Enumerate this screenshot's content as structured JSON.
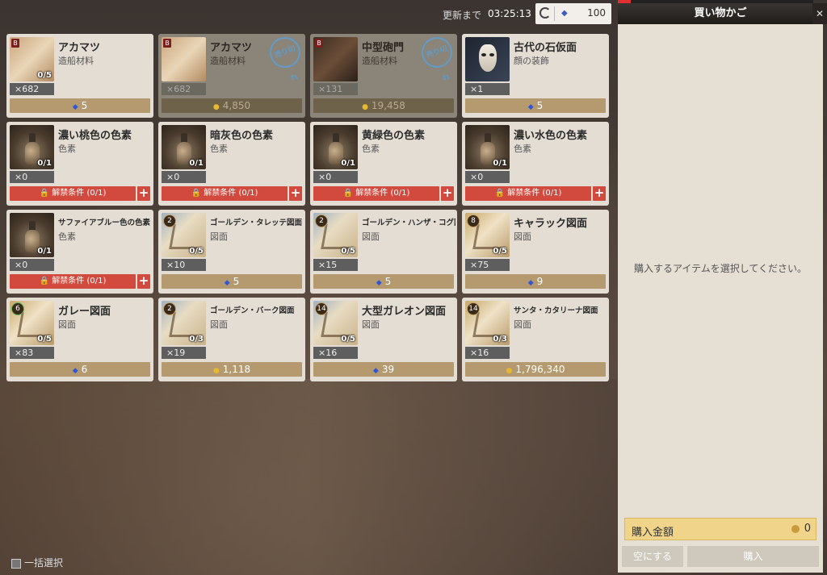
{
  "header": {
    "timer_label": "更新まで",
    "timer_value": "03:25:13",
    "gem_balance": "100"
  },
  "items": [
    {
      "name": "アカマツ",
      "category": "造船材料",
      "qty": "×682",
      "stock": "0/5",
      "price": "5",
      "currency": "gem",
      "thumb": "lumber",
      "badge": "B",
      "sold_out": false
    },
    {
      "name": "アカマツ",
      "category": "造船材料",
      "qty": "×682",
      "stock": "",
      "price": "4,850",
      "currency": "gold",
      "thumb": "lumber",
      "badge": "B",
      "sold_out": true,
      "stamp": "売り切れ"
    },
    {
      "name": "中型砲門",
      "category": "造船材料",
      "qty": "×131",
      "stock": "",
      "price": "19,458",
      "currency": "gold",
      "thumb": "cannon",
      "badge": "B",
      "sold_out": true,
      "stamp": "売り切れ"
    },
    {
      "name": "古代の石仮面",
      "category": "顔の装飾",
      "qty": "×1",
      "stock": "",
      "price": "5",
      "currency": "gem",
      "thumb": "mask",
      "badge": "",
      "sold_out": false
    },
    {
      "name": "濃い桃色の色素",
      "category": "色素",
      "qty": "×0",
      "stock": "0/1",
      "locked": true,
      "thumb": "bottle"
    },
    {
      "name": "暗灰色の色素",
      "category": "色素",
      "qty": "×0",
      "stock": "0/1",
      "locked": true,
      "thumb": "bottle"
    },
    {
      "name": "黄緑色の色素",
      "category": "色素",
      "qty": "×0",
      "stock": "0/1",
      "locked": true,
      "thumb": "bottle"
    },
    {
      "name": "濃い水色の色素",
      "category": "色素",
      "qty": "×0",
      "stock": "0/1",
      "locked": true,
      "thumb": "bottle"
    },
    {
      "name": "サファイアブルー色の色素",
      "category": "色素",
      "qty": "×0",
      "stock": "0/1",
      "locked": true,
      "thumb": "bottle",
      "small": true
    },
    {
      "name": "ゴールデン・タレッテ図面",
      "category": "図面",
      "qty": "×10",
      "stock": "0/5",
      "price": "5",
      "currency": "gem",
      "thumb": "scroll",
      "level": "2",
      "small": true
    },
    {
      "name": "ゴールデン・ハンザ・コグ図面",
      "category": "図面",
      "qty": "×15",
      "stock": "0/5",
      "price": "5",
      "currency": "gem",
      "thumb": "scroll",
      "level": "2",
      "small": true
    },
    {
      "name": "キャラック図面",
      "category": "図面",
      "qty": "×75",
      "stock": "0/5",
      "price": "9",
      "currency": "gem",
      "thumb": "scroll-gold",
      "level": "8"
    },
    {
      "name": "ガレー図面",
      "category": "図面",
      "qty": "×83",
      "stock": "0/5",
      "price": "6",
      "currency": "gem",
      "thumb": "scroll-gold",
      "level": "6",
      "level_green": true
    },
    {
      "name": "ゴールデン・バーク図面",
      "category": "図面",
      "qty": "×19",
      "stock": "0/3",
      "price": "1,118",
      "currency": "gold",
      "thumb": "scroll",
      "level": "2",
      "small": true
    },
    {
      "name": "大型ガレオン図面",
      "category": "図面",
      "qty": "×16",
      "stock": "0/5",
      "price": "39",
      "currency": "gem",
      "thumb": "scroll",
      "level": "14"
    },
    {
      "name": "サンタ・カタリーナ図面",
      "category": "図面",
      "qty": "×16",
      "stock": "0/3",
      "price": "1,796,340",
      "currency": "gold",
      "thumb": "scroll-gold",
      "level": "14",
      "small": true
    }
  ],
  "locked_label": "解禁条件 (0/1)",
  "cart": {
    "title": "買い物かご",
    "empty_message": "購入するアイテムを選択してください。",
    "total_label": "購入金額",
    "total_value": "0",
    "clear_button": "空にする",
    "buy_button": "購入"
  },
  "select_all_label": "一括選択",
  "icons": {
    "currency_gem": "gem-icon",
    "currency_gold": "gold-coin-icon",
    "lock": "lock-icon",
    "refresh": "refresh-icon"
  },
  "colors": {
    "price_bar": "#b49a6e",
    "locked_bar": "#d24a3e",
    "gem": "#2f55d8",
    "gold": "#e6b830",
    "total_bg": "#f0d489"
  }
}
